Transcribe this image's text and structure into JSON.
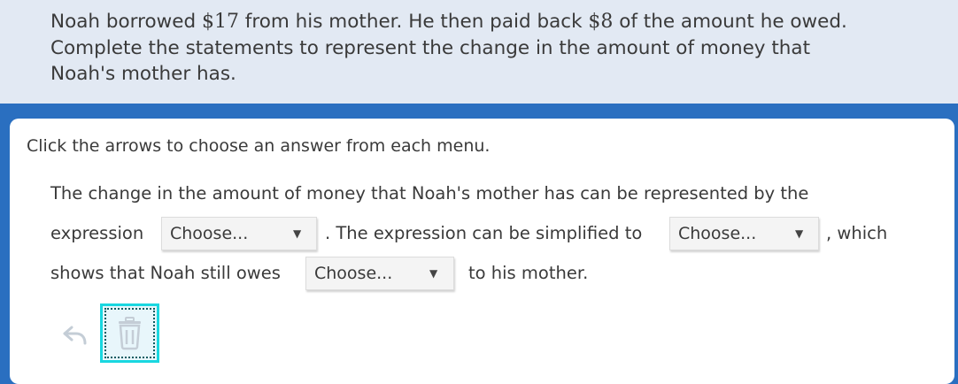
{
  "question": {
    "line1_a": "Noah borrowed ",
    "amount1": "$17",
    "line1_b": " from his mother. He then paid back ",
    "amount2": "$8",
    "line1_c": " of the amount he owed.",
    "line2": "Complete the statements to represent the change in the amount of money that",
    "line3": "Noah's mother has."
  },
  "instruction": "Click the arrows to choose an answer from each menu.",
  "statement": {
    "line1": "The change in the amount of money that Noah's mother has can be represented by the",
    "part_expression": "expression",
    "part_simplified": ". The expression can be simplified to",
    "part_which": ", which",
    "part_shows": "shows that Noah still owes",
    "part_end": "to his mother."
  },
  "dropdowns": {
    "expression": {
      "value": "Choose...",
      "arrow": "▼"
    },
    "simplified": {
      "value": "Choose...",
      "arrow": "▼"
    },
    "owes": {
      "value": "Choose...",
      "arrow": "▼"
    }
  },
  "tools": {
    "undo_icon": "undo-arrow-icon",
    "trash_icon": "trash-icon"
  },
  "colors": {
    "question_bg": "#e2e9f3",
    "frame_blue": "#2a6fc0",
    "trash_focus": "#19d7e0"
  }
}
